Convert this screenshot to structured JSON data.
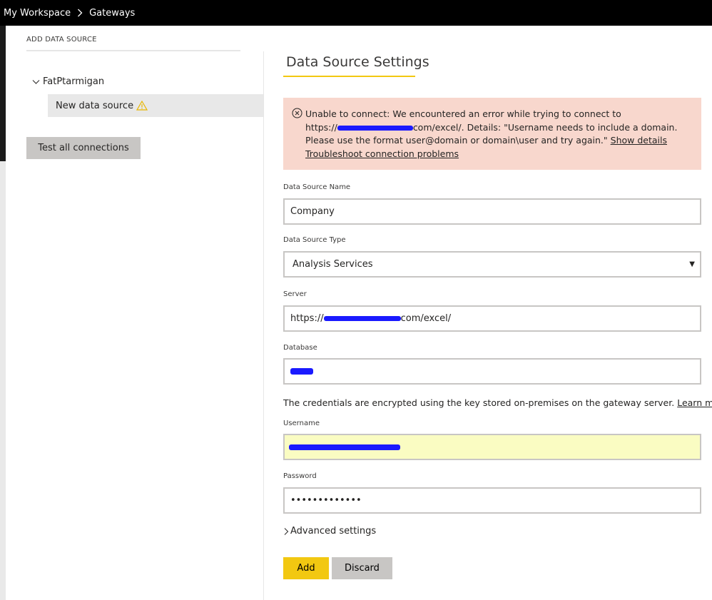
{
  "breadcrumb": {
    "workspace": "My Workspace",
    "page": "Gateways"
  },
  "sidebar": {
    "header": "ADD DATA SOURCE",
    "gateway_name": "FatPtarmigan",
    "selected_source": "New data source",
    "test_button": "Test all connections"
  },
  "main": {
    "title": "Data Source Settings",
    "error": {
      "line1": "Unable to connect: We encountered an error while trying to connect to",
      "line2_prefix": "https://",
      "line2_suffix": "com/excel/. Details: \"Username needs to include a domain.",
      "line3": "Please use the format user@domain or domain\\user and try again.\"",
      "show_details": "Show details",
      "troubleshoot": "Troubleshoot connection problems"
    },
    "fields": {
      "name_label": "Data Source Name",
      "name_value": "Company",
      "type_label": "Data Source Type",
      "type_value": "Analysis Services",
      "server_label": "Server",
      "server_prefix": "https://",
      "server_suffix": "com/excel/",
      "database_label": "Database",
      "username_label": "Username",
      "password_label": "Password",
      "password_value": "•••••••••••••"
    },
    "credentials_note": "The credentials are encrypted using the key stored on-premises on the gateway server.",
    "learn_more": "Learn more",
    "advanced": "Advanced settings",
    "add_button": "Add",
    "discard_button": "Discard"
  },
  "colors": {
    "accent": "#f2c811",
    "error_bg": "#f8d7cd",
    "username_bg": "#fafcc2"
  }
}
